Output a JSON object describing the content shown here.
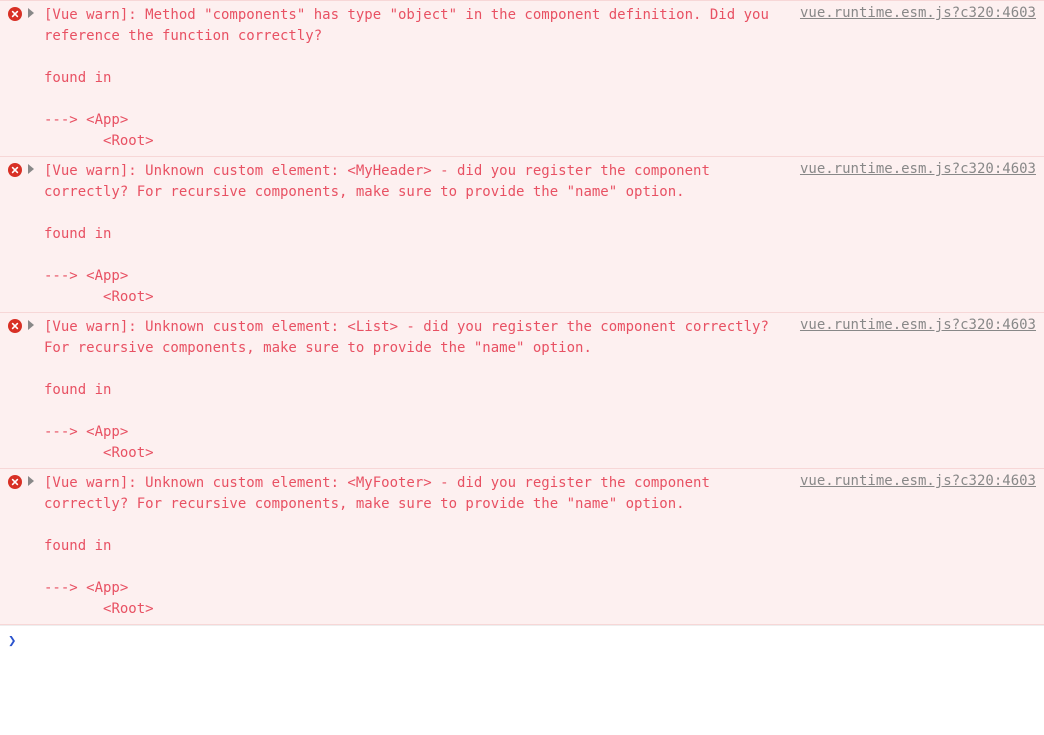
{
  "source_link": "vue.runtime.esm.js?c320:4603",
  "prompt_symbol": "❯",
  "entries": [
    {
      "message": "[Vue warn]: Method \"components\" has type \"object\" in the component definition. Did you reference the function correctly?\n\nfound in\n\n---> <App>\n       <Root>"
    },
    {
      "message": "[Vue warn]: Unknown custom element: <MyHeader> - did you register the component correctly? For recursive components, make sure to provide the \"name\" option.\n\nfound in\n\n---> <App>\n       <Root>"
    },
    {
      "message": "[Vue warn]: Unknown custom element: <List> - did you register the component correctly? For recursive components, make sure to provide the \"name\" option.\n\nfound in\n\n---> <App>\n       <Root>"
    },
    {
      "message": "[Vue warn]: Unknown custom element: <MyFooter> - did you register the component correctly? For recursive components, make sure to provide the \"name\" option.\n\nfound in\n\n---> <App>\n       <Root>"
    }
  ]
}
